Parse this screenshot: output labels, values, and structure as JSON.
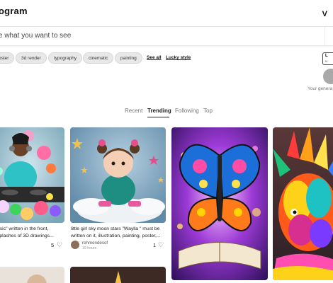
{
  "header": {
    "brand": "ogram",
    "menu_letter": "V"
  },
  "search": {
    "placeholder": "e what you want to see"
  },
  "chips": [
    "oster",
    "3d render",
    "typography",
    "cinematic",
    "painting"
  ],
  "links": {
    "see_all": "See all",
    "lucky": "Lucky style"
  },
  "right_panel": {
    "button_line1": "L",
    "button_line2": "M",
    "generate_text": "Your genera"
  },
  "tabs": [
    "Recent",
    "Trending",
    "Following",
    "Top"
  ],
  "active_tab": "Trending",
  "cards": [
    {
      "caption_lines": [
        "usic\" written in the front,",
        "splashes of 3D drawings..."
      ],
      "likes": "5"
    },
    {
      "caption_lines": [
        "little girl sky moon stars \"Waylla \" must be",
        "written on it, illustration, painting, poster,..."
      ],
      "likes": "1",
      "author": "rehmendesof",
      "time": "19 hours"
    },
    {
      "caption_lines": []
    },
    {
      "caption_lines": []
    }
  ],
  "icons": [
    "heart-icon",
    "user-avatar-icon"
  ],
  "colors": {
    "accent": "#222222",
    "chip_bg": "#e8e8e8",
    "search_border": "#e6e6e6"
  }
}
